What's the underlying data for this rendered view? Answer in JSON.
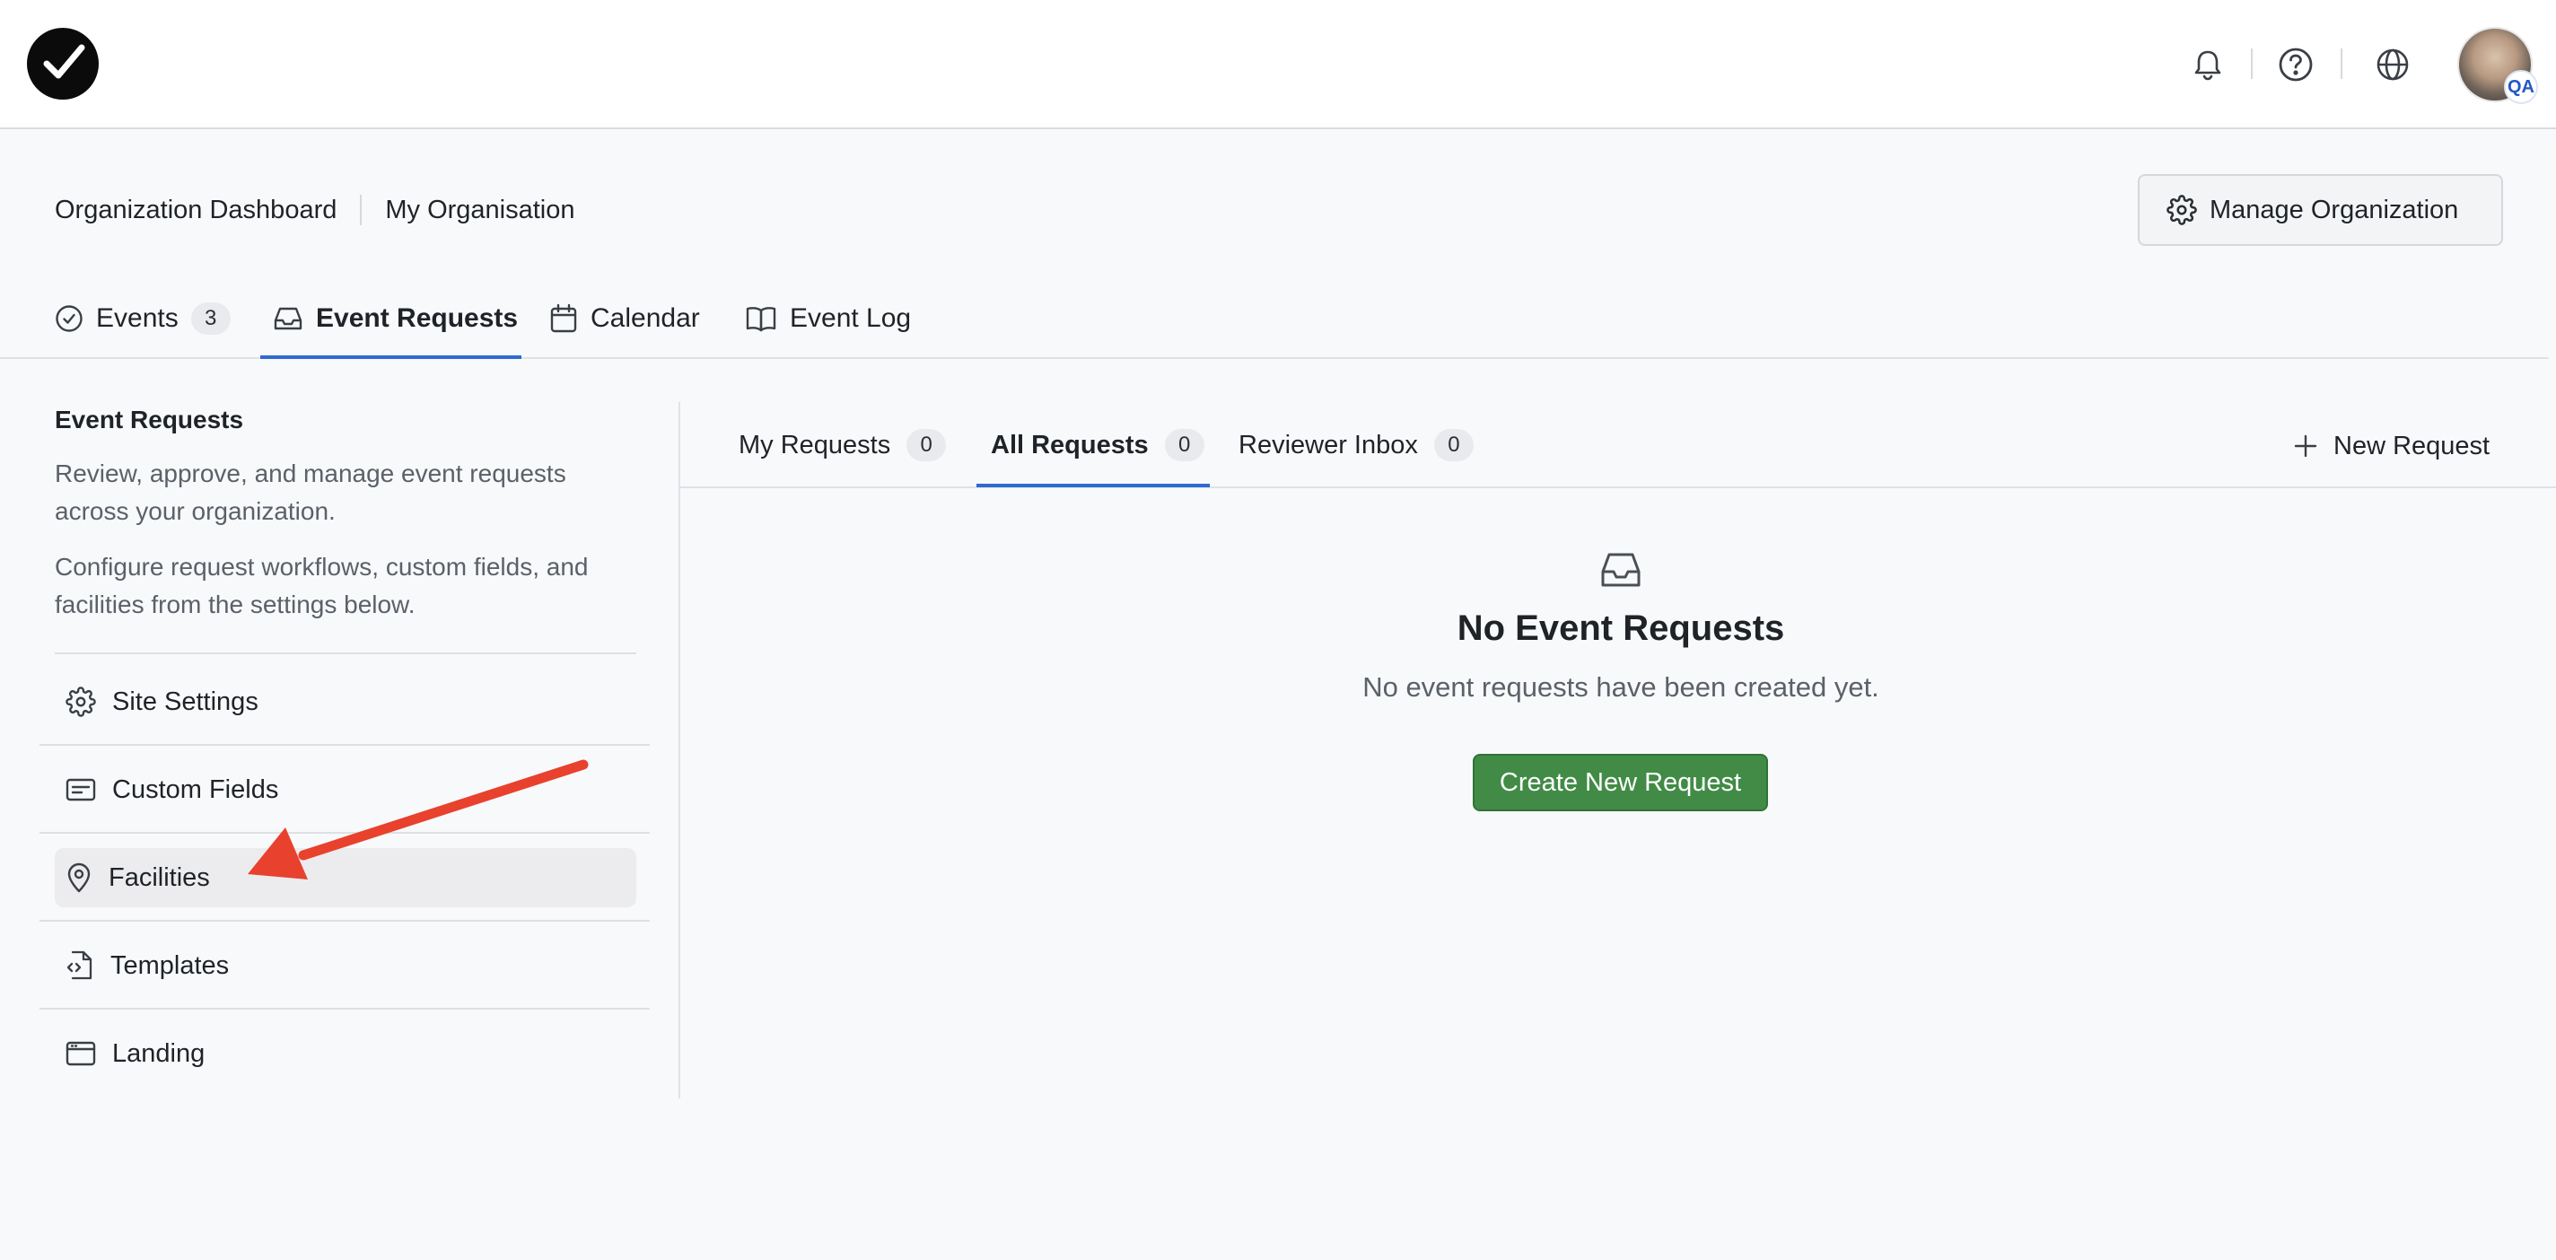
{
  "header": {
    "icons": [
      "logo-check-icon",
      "bell-icon",
      "help-circle-icon",
      "globe-icon"
    ],
    "avatar_badge": "QA"
  },
  "breadcrumb": {
    "items": [
      "Organization Dashboard",
      "My Organisation"
    ]
  },
  "manage_button": {
    "label": "Manage Organization",
    "icon": "gear-icon"
  },
  "main_tabs": [
    {
      "label": "Events",
      "count": "3",
      "icon": "check-circle-icon"
    },
    {
      "label": "Event Requests",
      "icon": "inbox-icon",
      "active": true
    },
    {
      "label": "Calendar",
      "icon": "calendar-icon"
    },
    {
      "label": "Event Log",
      "icon": "book-icon"
    }
  ],
  "sidebar": {
    "title": "Event Requests",
    "desc1": "Review, approve, and manage event requests across your organization.",
    "desc2": "Configure request workflows, custom fields, and facilities from the settings below.",
    "items": [
      {
        "label": "Site Settings",
        "icon": "gear-icon"
      },
      {
        "label": "Custom Fields",
        "icon": "form-field-icon"
      },
      {
        "label": "Facilities",
        "icon": "map-pin-icon",
        "selected": true
      },
      {
        "label": "Templates",
        "icon": "code-file-icon"
      },
      {
        "label": "Landing",
        "icon": "browser-window-icon"
      }
    ]
  },
  "sub_tabs": [
    {
      "label": "My Requests",
      "count": "0"
    },
    {
      "label": "All Requests",
      "count": "0",
      "active": true
    },
    {
      "label": "Reviewer Inbox",
      "count": "0"
    }
  ],
  "new_request": {
    "label": "New Request",
    "icon": "plus-icon"
  },
  "empty_state": {
    "icon": "inbox-icon",
    "title": "No Event Requests",
    "subtitle": "No event requests have been created yet.",
    "button": "Create New Request"
  },
  "colors": {
    "accent": "#2f6ad1",
    "primary_button": "#418b46",
    "annotation_arrow": "#e8412e"
  }
}
